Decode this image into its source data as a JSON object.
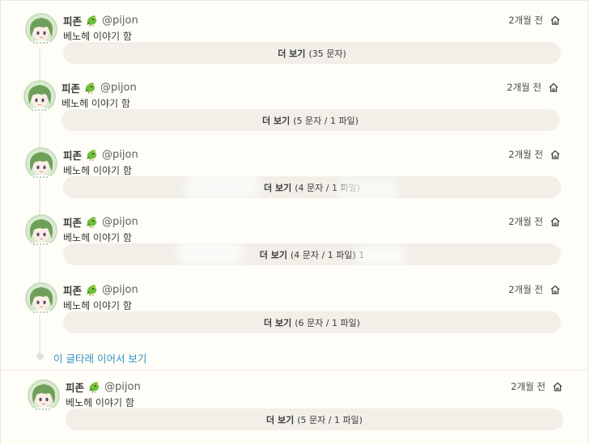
{
  "continue_label": "이 글타래 이어서 보기",
  "notes": [
    {
      "name": "피존",
      "handle": "@pijon",
      "time": "2개월 전",
      "text": "베노헤 이야기 함",
      "more_label": "더 보기",
      "more_detail": "(35 문자)"
    },
    {
      "name": "피존",
      "handle": "@pijon",
      "time": "2개월 전",
      "text": "베노헤 이야기 함",
      "more_label": "더 보기",
      "more_detail": "(5 문자 / 1 파일)"
    },
    {
      "name": "피존",
      "handle": "@pijon",
      "time": "2개월 전",
      "text": "베노헤 이야기 함",
      "more_label": "더 보기",
      "more_detail": "(4 문자 / 1 파일)"
    },
    {
      "name": "피존",
      "handle": "@pijon",
      "time": "2개월 전",
      "text": "베노헤 이야기 함",
      "more_label": "더 보기",
      "more_detail": "(4 문자 / 1 파일) 1"
    },
    {
      "name": "피존",
      "handle": "@pijon",
      "time": "2개월 전",
      "text": "베노헤 이야기 함",
      "more_label": "더 보기",
      "more_detail": "(6 문자 / 1 파일)"
    },
    {
      "name": "피존",
      "handle": "@pijon",
      "time": "2개월 전",
      "text": "베노헤 이야기 함",
      "more_label": "더 보기",
      "more_detail": "(5 문자 / 1 파일)"
    }
  ],
  "colors": {
    "accent_link": "#2d93c6",
    "background": "#fffdf7",
    "pill": "#f1efe8"
  },
  "icons": {
    "avatar": "green-haired-character-avatar",
    "emoji": "green-bird-emoji",
    "visibility": "home-icon"
  }
}
